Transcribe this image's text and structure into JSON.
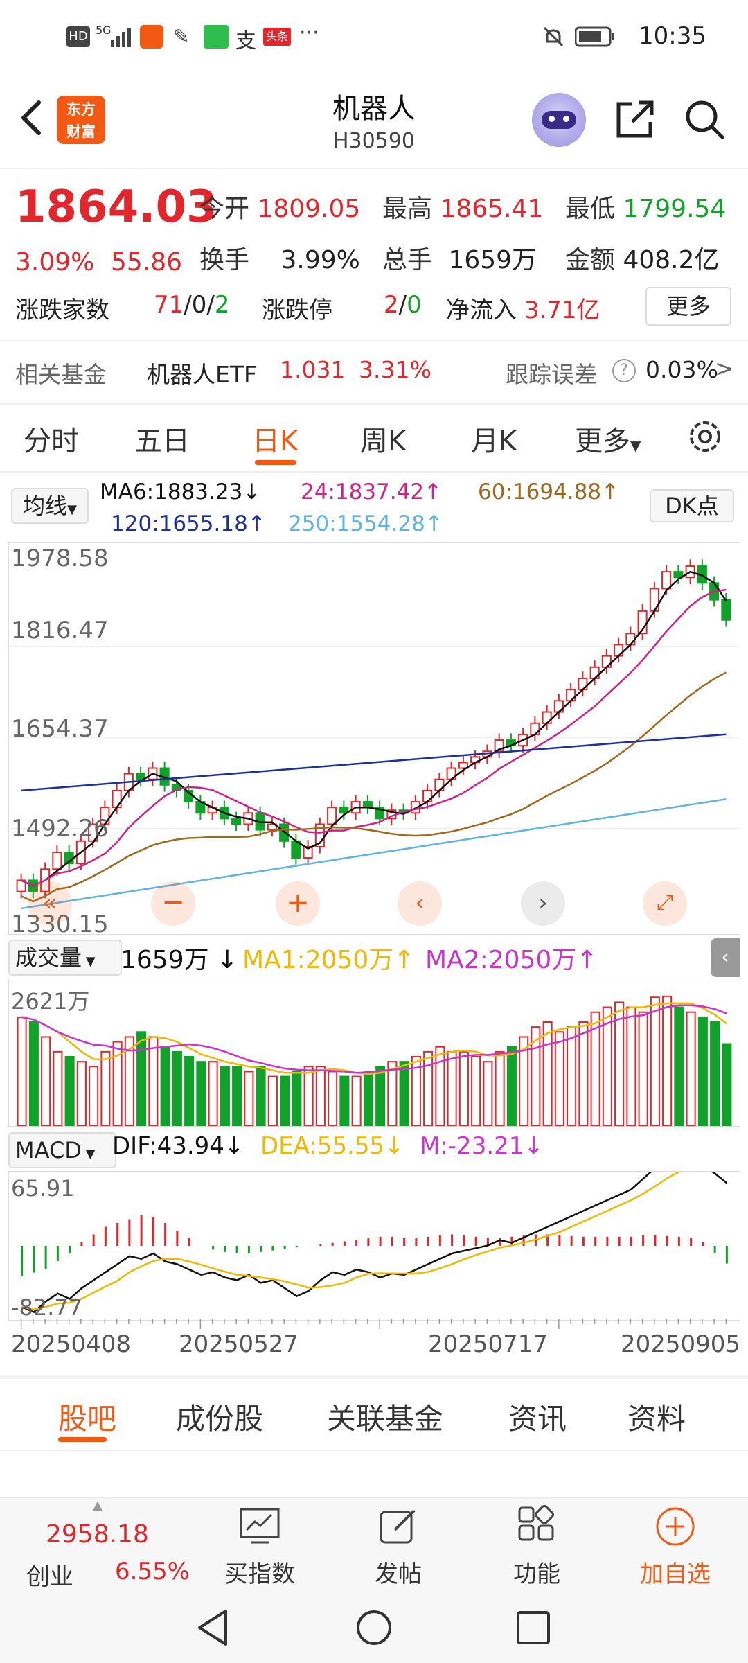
{
  "status": {
    "time": "10:35",
    "network": "5G",
    "badge": "头条"
  },
  "header": {
    "logo_line1": "东方",
    "logo_line2": "财富",
    "title": "机器人",
    "code": "H30590"
  },
  "quote": {
    "price": "1864.03",
    "change_pct": "3.09%",
    "change_amt": "55.86",
    "open_label": "今开",
    "open": "1809.05",
    "high_label": "最高",
    "high": "1865.41",
    "low_label": "最低",
    "low": "1799.54",
    "turnover_label": "换手",
    "turnover": "3.99%",
    "volume_label": "总手",
    "volume": "1659万",
    "amount_label": "金额",
    "amount": "408.2亿",
    "breadth_label": "涨跌家数",
    "breadth_up": "71",
    "breadth_flat": "0",
    "breadth_down": "2",
    "limit_label": "涨跌停",
    "limit_up": "2",
    "limit_down": "0",
    "inflow_label": "净流入",
    "inflow": "3.71亿",
    "more": "更多"
  },
  "fund": {
    "label": "相关基金",
    "name": "机器人ETF",
    "price": "1.031",
    "pct": "3.31%",
    "err_label": "跟踪误差",
    "err_value": "0.03%",
    "chevron": ">"
  },
  "tabs": [
    "分时",
    "五日",
    "日K",
    "周K",
    "月K",
    "更多"
  ],
  "active_tab": 2,
  "ma": {
    "selector": "均线",
    "ma6": "MA6:1883.23↓",
    "ma24": "24:1837.42↑",
    "ma60": "60:1694.88↑",
    "ma120": "120:1655.18↑",
    "ma250": "250:1554.28↑",
    "dk": "DK点"
  },
  "price_axis": {
    "top": "1978.58",
    "mid1": "1816.47",
    "mid2": "1654.37",
    "mid3": "1492.26",
    "bottom": "1330.15"
  },
  "volume": {
    "selector": "成交量",
    "value": "1659万",
    "ma1": "MA1:2050万",
    "ma2": "MA2:2050万",
    "max": "2621万"
  },
  "macd": {
    "selector": "MACD",
    "dif": "DIF:43.94",
    "dea": "DEA:55.55",
    "m": "M:-23.21",
    "max": "65.91",
    "min": "-82.77"
  },
  "dates": [
    "20250408",
    "20250527",
    "20250717",
    "20250905"
  ],
  "colors": {
    "accent": "#f25a13",
    "up": "#e3262c",
    "down": "#11a329",
    "ma6": "#111111",
    "ma24": "#d0218a",
    "ma60": "#a0681e",
    "ma120": "#1c2f9a",
    "ma250": "#5fb3e6",
    "ma1": "#f0b800",
    "ma2": "#cc33cc"
  },
  "bottom_tabs": [
    "股吧",
    "成份股",
    "关联基金",
    "资讯",
    "资料"
  ],
  "bottom_active": 0,
  "toolbar": {
    "index_value": "2958.18",
    "index_name": "创业",
    "index_pct": "6.55%",
    "buy": "买指数",
    "post": "发帖",
    "func": "功能",
    "add": "加自选"
  },
  "chart_data": {
    "type": "candlestick",
    "title": "机器人 H30590 日K",
    "ylim": [
      1330.15,
      1978.58
    ],
    "x_labels": [
      "20250408",
      "20250527",
      "20250717",
      "20250905"
    ],
    "close_series": [
      1400,
      1380,
      1420,
      1450,
      1430,
      1470,
      1500,
      1530,
      1560,
      1590,
      1580,
      1600,
      1570,
      1560,
      1540,
      1520,
      1530,
      1510,
      1500,
      1520,
      1490,
      1500,
      1470,
      1440,
      1460,
      1500,
      1530,
      1520,
      1540,
      1530,
      1510,
      1525,
      1520,
      1540,
      1560,
      1580,
      1600,
      1610,
      1620,
      1630,
      1650,
      1640,
      1660,
      1680,
      1700,
      1720,
      1740,
      1760,
      1780,
      1800,
      1820,
      1840,
      1880,
      1920,
      1950,
      1940,
      1960,
      1930,
      1900,
      1864.03
    ],
    "volume_series": [
      2200,
      2100,
      1800,
      1500,
      1400,
      1300,
      1200,
      1500,
      1700,
      1800,
      1900,
      1800,
      1600,
      1500,
      1400,
      1300,
      1300,
      1200,
      1200,
      1100,
      1200,
      1000,
      1000,
      1100,
      1200,
      1200,
      1100,
      1000,
      1000,
      1100,
      1200,
      1300,
      1300,
      1400,
      1500,
      1600,
      1500,
      1500,
      1400,
      1300,
      1500,
      1600,
      1800,
      2000,
      2100,
      1900,
      2000,
      2100,
      2300,
      2400,
      2500,
      2400,
      2300,
      2600,
      2621,
      2400,
      2300,
      2200,
      2100,
      1659
    ],
    "macd_hist": [
      -40,
      -35,
      -30,
      -20,
      -10,
      5,
      15,
      25,
      30,
      35,
      40,
      38,
      30,
      20,
      10,
      0,
      -5,
      -8,
      -10,
      -10,
      -8,
      -6,
      -4,
      -2,
      0,
      2,
      4,
      6,
      8,
      10,
      12,
      12,
      10,
      10,
      12,
      14,
      15,
      14,
      12,
      10,
      10,
      12,
      14,
      15,
      15,
      14,
      13,
      12,
      12,
      12,
      12,
      12,
      14,
      14,
      13,
      12,
      10,
      5,
      -10,
      -23.21
    ],
    "series": [
      {
        "name": "MA6",
        "value": 1883.23
      },
      {
        "name": "MA24",
        "value": 1837.42
      },
      {
        "name": "MA60",
        "value": 1694.88
      },
      {
        "name": "MA120",
        "value": 1655.18
      },
      {
        "name": "MA250",
        "value": 1554.28
      }
    ]
  }
}
